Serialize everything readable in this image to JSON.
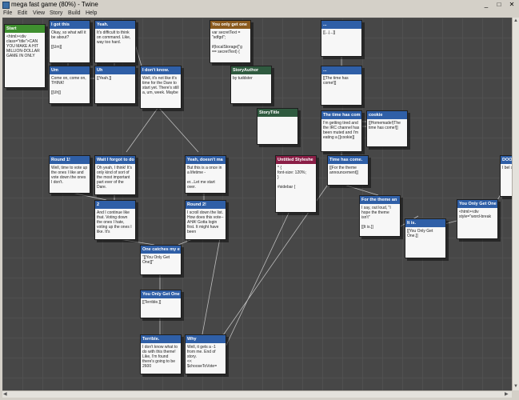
{
  "window": {
    "title": "mega fast game (80%) - Twine",
    "min_label": "_",
    "max_label": "□",
    "close_label": "✕"
  },
  "menu": [
    "File",
    "Edit",
    "View",
    "Story",
    "Build",
    "Help"
  ],
  "passages": [
    {
      "title": "Start",
      "text": "<html><div class=\"title\">CAN YOU MAKE A HIT MILLION-DOLLAR GAME IN ONLY",
      "kind": "start"
    },
    {
      "title": "I got this",
      "text": "Okay, so what will it be about?\n\n[[Um]]",
      "kind": "normal"
    },
    {
      "title": "Yeah.",
      "text": "It's difficult to think on command. Like, way too hard.",
      "kind": "normal"
    },
    {
      "title": "You only get one",
      "text": "var secretText = \"sdfgd\";\n\nif(localStorage[\"g\n== secretText) {",
      "kind": "script"
    },
    {
      "title": "...",
      "text": "[[...|...]]",
      "kind": "normal"
    },
    {
      "title": "Um",
      "text": "Come on, come on, THINK!\n\n[[Uh]]",
      "kind": "normal"
    },
    {
      "title": "Uh",
      "text": "[[Yeah.]]",
      "kind": "normal"
    },
    {
      "title": "I don't know.",
      "text": "Well, it's not like it's time for the Dare to start yet. There's still a, um, week. Maybe",
      "kind": "normal"
    },
    {
      "title": "StoryAuthor",
      "text": "by tuddster",
      "kind": "special"
    },
    {
      "title": "...",
      "text": "[[The time has come!]]",
      "kind": "normal"
    },
    {
      "title": "StoryTitle",
      "text": "",
      "kind": "special"
    },
    {
      "title": "The time has com",
      "text": "I'm getting tired and the IRC channel has been muted and I'm eating a [[cookie]]",
      "kind": "normal"
    },
    {
      "title": "cookie",
      "text": "[[Homemade!|The time has come!]]",
      "kind": "normal"
    },
    {
      "title": "Round 1!",
      "text": "Well, time to vote up the ones I like and vote down the ones I don't.",
      "kind": "normal"
    },
    {
      "title": "Wait I forgot to do",
      "text": "Oh yeah, I think! It's only kind of sort of the most important part ever of the Dare.",
      "kind": "normal"
    },
    {
      "title": "Yeah, doesn't ma",
      "text": "But this is a once in a lifetime -\n\ner...Let me start over.",
      "kind": "normal"
    },
    {
      "title": "Untitled Styleshe",
      "text": "* {\nfont-size: 120%;\n}\n\n#sidebar {",
      "kind": "style"
    },
    {
      "title": "Time has come.",
      "text": "[[For the theme announcement]]",
      "kind": "normal"
    },
    {
      "title": "DOO",
      "text": "I bel spec ever",
      "kind": "normal"
    },
    {
      "title": "2",
      "text": "And I continue like that. Voting down the ones I hate, voting up the ones I like. It's",
      "kind": "normal"
    },
    {
      "title": "Round 2!",
      "text": "I scroll down the list. How does this vote-- AHA! Gotta login first. It might have been",
      "kind": "normal"
    },
    {
      "title": "For the theme an",
      "text": "I say, out loud, \"I hope the theme isn't\"\n\n[[It is.]]",
      "kind": "normal"
    },
    {
      "title": "You Only Get One",
      "text": "<html><div style=\"word-break",
      "kind": "normal"
    },
    {
      "title": "It is.",
      "text": "[[You Only Get One.]]",
      "kind": "normal"
    },
    {
      "title": "One catches my e",
      "text": "\"[[You Only Get One]]\"",
      "kind": "normal"
    },
    {
      "title": "You Only Get One",
      "text": "[[Terrible.]]",
      "kind": "normal"
    },
    {
      "title": "Terrible.",
      "text": "I don't know what to do with this theme! Like, I'm found there's going to be 2600",
      "kind": "normal"
    },
    {
      "title": "Why",
      "text": "Well, it gets a -1 from me. End of story.\n<<\n$chooseToVote=",
      "kind": "normal"
    }
  ]
}
